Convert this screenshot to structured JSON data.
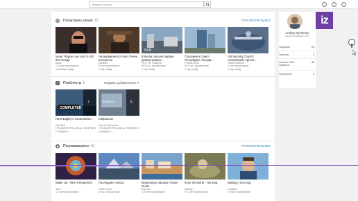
{
  "search": {
    "placeholder": "Введите запрос"
  },
  "brand": {
    "logo_text": "iz"
  },
  "watch_later": {
    "title": "Посмотреть позже",
    "count": "13",
    "view_all": "ПРОСМОТРЕТЬ ВСЕ",
    "videos": [
      {
        "title": "Muse: Rogue Live Loin l LIVE 007 Следи",
        "channel": "Muse",
        "views": "1,3 млн просмотров",
        "age": "4 месяца назад",
        "duration": "1:38"
      },
      {
        "title": "Аж нервишки по телу! Очень интересно",
        "channel": "positivid",
        "views": "2 млн просмотров",
        "age": "1 год назад",
        "duration": "8:01"
      },
      {
        "title": "В Китае прошла первая демонстрация...",
        "channel": "РЕН ТВ. Новости",
        "views": "543 тыс. просмотров",
        "age": "1 год назад",
        "duration": "1:04"
      },
      {
        "title": "Спасение в Санкт-Петербурге: Погода...",
        "channel": "Pravda.news",
        "views": "937 тыс. просмотров",
        "age": "1 год назад",
        "duration": "2:38"
      },
      {
        "title": "UN Security Council Unanimously Agrees...",
        "channel": "United Nations",
        "views": "2 млн просмотров",
        "age": "1 год назад",
        "duration": "1:40"
      }
    ]
  },
  "playlists": {
    "title": "Плейлисты",
    "count": "2",
    "sort": "Недавно добавленные",
    "items": [
      {
        "title": "Ross Edgley's Great British ...",
        "channel": "Red Bull",
        "note": "ПРОСМОТРЕТЬ ВЕСЬ ПЛЕЙЛИСТ (7 ВИДЕО)",
        "badge": "COMPLETED",
        "count": "7"
      },
      {
        "title": "Избранное",
        "channel": "Andrey Rychenko",
        "note": "ПРОСМОТРЕТЬ ВЕСЬ ПЛЕЙЛИСТ (5 ВИДЕО)",
        "count": "5"
      }
    ]
  },
  "liked": {
    "title": "Понравившиеся",
    "count": "19",
    "view_all": "ПРОСМОТРЕТЬ ВСЕ",
    "videos": [
      {
        "title": "Wake Up - Alien Perspective",
        "channel": "SHC",
        "views": "1,2 млн просмотров",
        "age": "1 год назад",
        "duration": "4:19"
      },
      {
        "title": "Последние Аляска",
        "channel": "Travel Guru",
        "views": "8 тыс. просмотров",
        "age": "1 год назад",
        "duration": "3:11"
      },
      {
        "title": "Montenegro Vacation Travel Guide",
        "channel": "Expedia",
        "views": "3,4 млн просмотров",
        "age": "5 лет назад",
        "duration": "5:41"
      },
      {
        "title": "Inner It's Worth - Hot Dog",
        "channel": "Nikolay",
        "views": "9,1 млн просмотров",
        "age": "1 год назад",
        "duration": "5:07"
      },
      {
        "title": "Making A Hot Dog",
        "channel": "Cooking",
        "views": "14 тыс. просмотров",
        "age": "1 год назад",
        "duration": "3:32"
      }
    ]
  },
  "profile": {
    "name": "Andrey Rychenko",
    "since": "Год регистрации: 2013",
    "stats": [
      {
        "label": "Подписки",
        "value": "20"
      },
      {
        "label": "Загрузки",
        "value": "4"
      },
      {
        "label": "Отметки 'Мне нравится'",
        "value": "43"
      },
      {
        "label": "Плейлисты",
        "value": "2"
      }
    ]
  },
  "playback": {
    "progress_fraction": 0.35
  }
}
